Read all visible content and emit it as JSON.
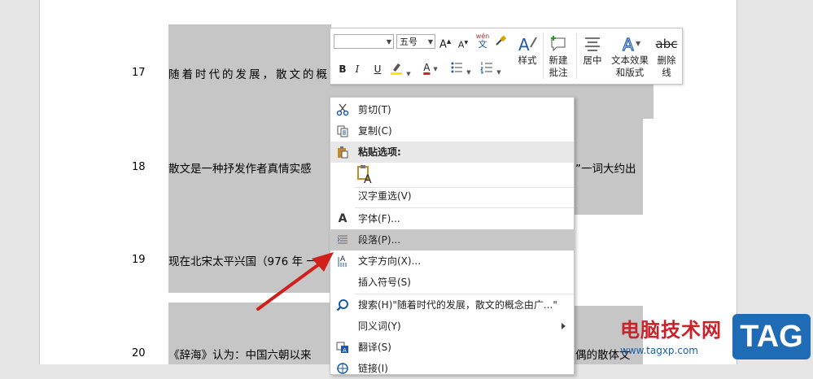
{
  "document": {
    "top_partial_text": "",
    "lines": [
      {
        "num": "17",
        "text": "随着时代的发展，散文的概"
      },
      {
        "num": "18",
        "text": "散文是一种抒发作者真情实感",
        "tail": "”一词大约出"
      },
      {
        "num": "19",
        "text": "现在北宋太平兴国（976 年 一"
      },
      {
        "num": "20",
        "text": "《辞海》认为：中国六朝以来",
        "tail": "偶的散体文"
      }
    ]
  },
  "mini_toolbar": {
    "font_name": "",
    "font_size": "五号",
    "grow_font": "A",
    "shrink_font": "A",
    "phonetic": "wén",
    "phonetic_char": "文",
    "bold": "B",
    "italic": "I",
    "underline": "U",
    "font_color": "A",
    "styles_label": "样式",
    "new_comment_label_1": "新建",
    "new_comment_label_2": "批注",
    "center_label": "居中",
    "text_effect_label_1": "文本效果",
    "text_effect_label_2": "和版式",
    "strike_label_1": "删除",
    "strike_label_2": "线",
    "strike_glyph": "abc"
  },
  "context_menu": {
    "items": [
      {
        "label": "剪切(T)",
        "icon": "scissors-icon"
      },
      {
        "label": "复制(C)",
        "icon": "copy-icon"
      },
      {
        "label": "粘贴选项:",
        "icon": "paste-icon"
      },
      {
        "label": "",
        "icon": "paste-text-only-icon"
      },
      {
        "label": "汉字重选(V)",
        "icon": ""
      },
      {
        "label": "字体(F)...",
        "icon": "font-icon"
      },
      {
        "label": "段落(P)...",
        "icon": "paragraph-icon"
      },
      {
        "label": "文字方向(X)...",
        "icon": "text-direction-icon"
      },
      {
        "label": "插入符号(S)",
        "icon": ""
      },
      {
        "label": "搜索(H)\"随着时代的发展，散文的概念由广...\"",
        "icon": "search-icon"
      },
      {
        "label": "同义词(Y)",
        "icon": ""
      },
      {
        "label": "翻译(S)",
        "icon": "translate-icon"
      },
      {
        "label": "链接(I)",
        "icon": "link-icon"
      }
    ],
    "highlighted": "段落(P)..."
  },
  "watermark": {
    "site_name": "电脑技术网",
    "url": "www.tagxp.com",
    "tag": "TAG"
  },
  "colors": {
    "selection": "#c6c6c6",
    "arrow": "#d0201c",
    "menu_highlight": "#c8c8c8",
    "font_color_bar": "#e02020",
    "highlight_bar": "#ffe600",
    "brand_blue": "#1f6bb6",
    "brand_red": "#c7232b"
  }
}
